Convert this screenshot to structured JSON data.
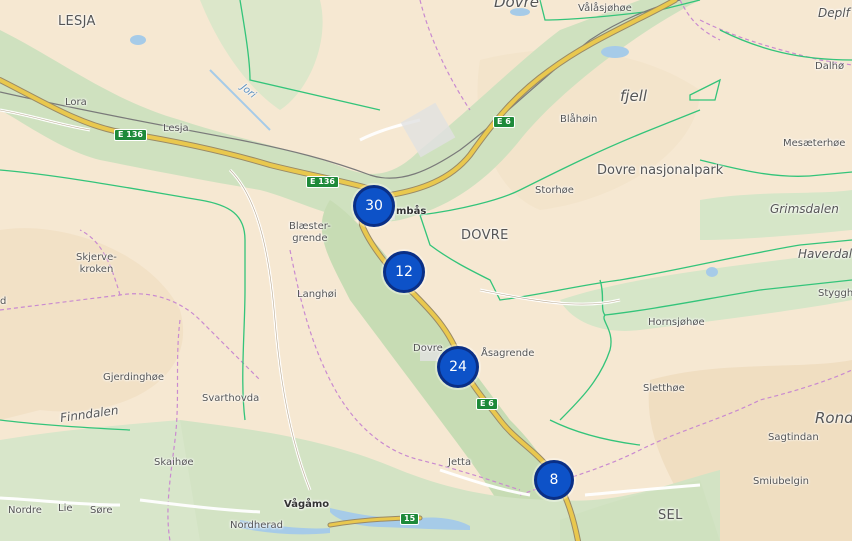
{
  "colors": {
    "land": "#f6e8d2",
    "forest": "#d3e3c4",
    "valley": "#bfd9b0",
    "road_main": "#e9c84e",
    "road_casing": "#9a8a66",
    "boundary_green": "#33c47a",
    "boundary_pink": "#c98ad0",
    "water": "#a6cbe8",
    "cluster_fill": "#0d52c8",
    "cluster_border": "#0a2f86"
  },
  "labels": {
    "lesja_region": "LESJA",
    "dovre_top": "Dovre",
    "valasjohoe": "Vålåsjøhøe",
    "deplf": "Deplf",
    "dalhoe": "Dalhø",
    "lora": "Lora",
    "jori": "Jori",
    "fjell": "fjell",
    "blahoin": "Blåhøin",
    "mesaeterhoe": "Mesæterhøe",
    "lesja": "Lesja",
    "dovre_np": "Dovre nasjonalpark",
    "storhoe": "Storhøe",
    "dombas": "mbås",
    "grimsdalen": "Grimsdalen",
    "blaester": "Blæster-",
    "grende": "grende",
    "dovre_region": "DOVRE",
    "haverdal": "Haverdal",
    "skjerve": "Skjerve-",
    "kroken": "kroken",
    "stygg": "Styggh",
    "langhoi": "Langhøi",
    "hornsjohoe": "Hornsjøhøe",
    "dovre_town": "Dovre",
    "asagrende": "Åsagrende",
    "gjerdinghoe": "Gjerdinghøe",
    "sletthoe": "Sletthøe",
    "svarthovda": "Svarthovda",
    "finndalen": "Finndalen",
    "rond": "Rond",
    "sagtindan": "Sagtindan",
    "skaihoe": "Skaihøe",
    "jetta": "Jetta",
    "smiubelgin": "Smiubelgin",
    "vagamo": "Vågåmo",
    "nordre": "Nordre",
    "lie": "Lie",
    "sore": "Søre",
    "nordherad": "Nordherad",
    "sel": "SEL",
    "d_edge": "d"
  },
  "roads": {
    "e136_label": "E 136",
    "e136_label_2": "E 136",
    "e6_label_north": "E 6",
    "e6_label_south": "E 6",
    "r15_label": "15"
  },
  "clusters": [
    {
      "count": "30"
    },
    {
      "count": "12"
    },
    {
      "count": "24"
    },
    {
      "count": "8"
    }
  ]
}
